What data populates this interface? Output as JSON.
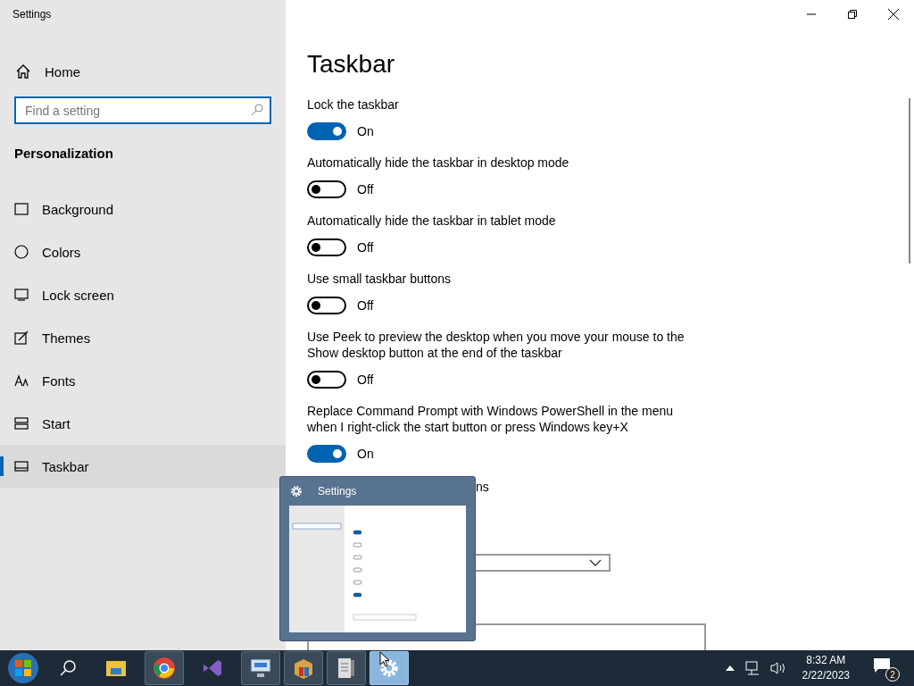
{
  "window": {
    "title": "Settings"
  },
  "sidebar": {
    "home": "Home",
    "search": {
      "placeholder": "Find a setting"
    },
    "section": "Personalization",
    "items": [
      {
        "label": "Background",
        "selected": false
      },
      {
        "label": "Colors",
        "selected": false
      },
      {
        "label": "Lock screen",
        "selected": false
      },
      {
        "label": "Themes",
        "selected": false
      },
      {
        "label": "Fonts",
        "selected": false
      },
      {
        "label": "Start",
        "selected": false
      },
      {
        "label": "Taskbar",
        "selected": true
      }
    ]
  },
  "main": {
    "title": "Taskbar",
    "toggles": [
      {
        "label": "Lock the taskbar",
        "on": true,
        "state_text": "On"
      },
      {
        "label": "Automatically hide the taskbar in desktop mode",
        "on": false,
        "state_text": "Off"
      },
      {
        "label": "Automatically hide the taskbar in tablet mode",
        "on": false,
        "state_text": "Off"
      },
      {
        "label": "Use small taskbar buttons",
        "on": false,
        "state_text": "Off"
      },
      {
        "label": "Use Peek to preview the desktop when you move your mouse to the Show desktop button at the end of the taskbar",
        "on": false,
        "state_text": "Off"
      },
      {
        "label": "Replace Command Prompt with Windows PowerShell in the menu when I right-click the start button or press Windows key+X",
        "on": true,
        "state_text": "On"
      }
    ],
    "badges_label": "ns"
  },
  "thumbnail_popup": {
    "title": "Settings"
  },
  "taskbar": {
    "apps": [
      {
        "kind": "start",
        "running": false,
        "active": false
      },
      {
        "kind": "search",
        "running": false,
        "active": false
      },
      {
        "kind": "folder",
        "running": false,
        "active": false
      },
      {
        "kind": "browser",
        "running": true,
        "active": false
      },
      {
        "kind": "studio",
        "running": false,
        "active": false
      },
      {
        "kind": "remote",
        "running": true,
        "active": false
      },
      {
        "kind": "package",
        "running": true,
        "active": false
      },
      {
        "kind": "document",
        "running": true,
        "active": false
      },
      {
        "kind": "gear",
        "running": true,
        "active": true
      }
    ],
    "time": "8:32 AM",
    "date": "2/22/2023",
    "notifications": "2"
  }
}
